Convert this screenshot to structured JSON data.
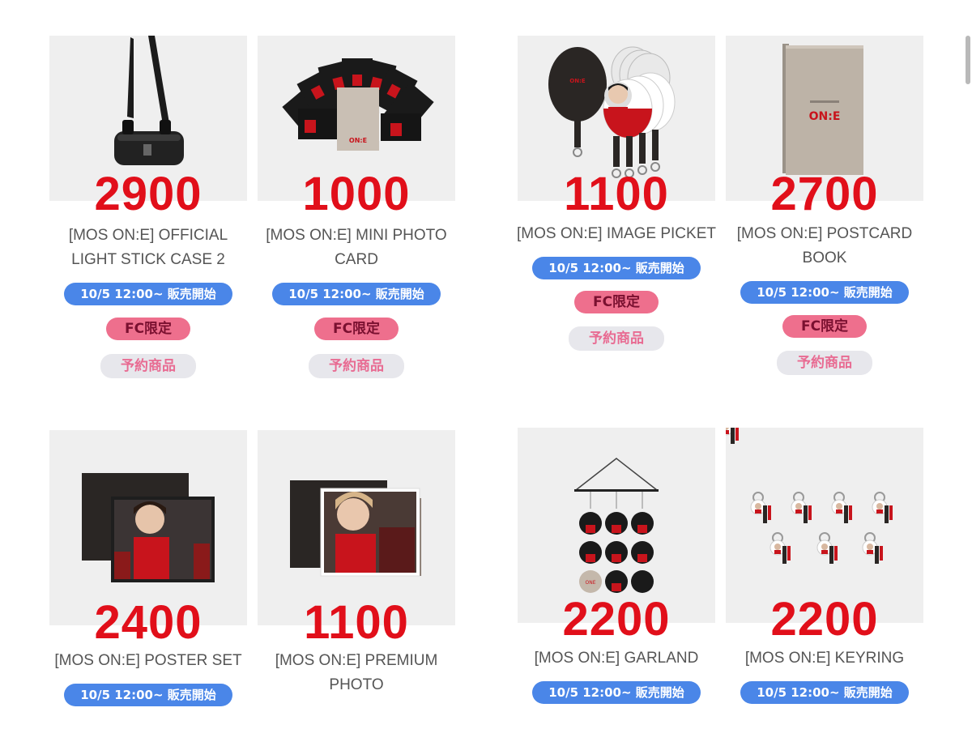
{
  "colors": {
    "price": "#e10f1a",
    "date_badge": "#4a86e8",
    "fc_badge": "#ee6f8d",
    "reserve_badge": "#e7e7ec",
    "thumb_bg": "#efefef"
  },
  "products": [
    {
      "price": "2900",
      "title": "[MOS ON:E] OFFICIAL LIGHT STICK CASE 2",
      "sale_badge": "10/5 12:00~ 販売開始",
      "fc_badge": "FC限定",
      "reserve_badge": "予約商品",
      "image": "light-stick-case"
    },
    {
      "price": "1000",
      "title": "[MOS ON:E] MINI PHOTO CARD",
      "sale_badge": "10/5 12:00~ 販売開始",
      "fc_badge": "FC限定",
      "reserve_badge": "予約商品",
      "image": "photo-cards",
      "logo_text": "ON:E"
    },
    {
      "price": "1100",
      "title": "[MOS ON:E] IMAGE PICKET",
      "sale_badge": "10/5 12:00~ 販売開始",
      "fc_badge": "FC限定",
      "reserve_badge": "予約商品",
      "image": "image-picket",
      "logo_text": "ON:E"
    },
    {
      "price": "2700",
      "title": "[MOS ON:E] POSTCARD BOOK",
      "sale_badge": "10/5 12:00~ 販売開始",
      "fc_badge": "FC限定",
      "reserve_badge": "予約商品",
      "image": "postcard-book",
      "logo_text": "ON:E"
    },
    {
      "price": "2400",
      "title": "[MOS ON:E] POSTER SET",
      "sale_badge": "10/5 12:00~ 販売開始",
      "image": "poster-set"
    },
    {
      "price": "1100",
      "title": "[MOS ON:E] PREMIUM PHOTO",
      "image": "premium-photo"
    },
    {
      "price": "2200",
      "title": "[MOS ON:E] GARLAND",
      "sale_badge": "10/5 12:00~ 販売開始",
      "image": "garland",
      "logo_text": "ONE"
    },
    {
      "price": "2200",
      "title": "[MOS ON:E] KEYRING",
      "sale_badge": "10/5 12:00~ 販売開始",
      "image": "keyring"
    }
  ]
}
